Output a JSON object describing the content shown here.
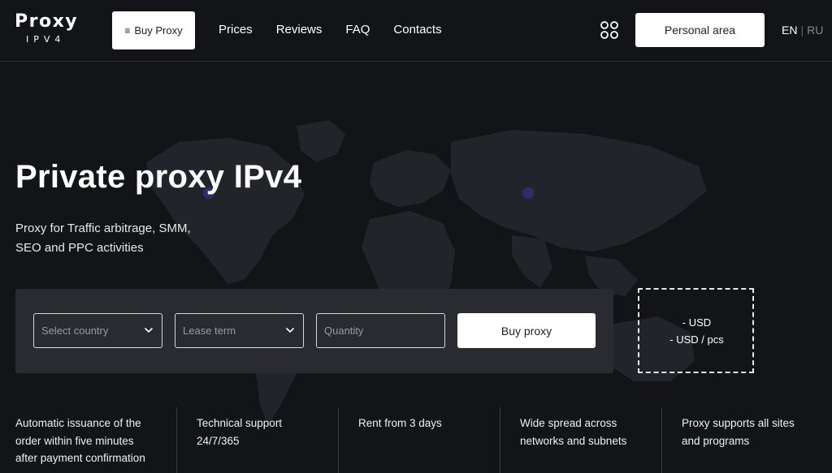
{
  "header": {
    "logo": {
      "main": "Proxy",
      "sub": "IPV4"
    },
    "buy_button": {
      "icon": "menu-icon",
      "label": "Buy Proxy"
    },
    "nav": [
      {
        "label": "Prices"
      },
      {
        "label": "Reviews"
      },
      {
        "label": "FAQ"
      },
      {
        "label": "Contacts"
      }
    ],
    "apps_icon": "grid-apps-icon",
    "personal_area_label": "Personal area",
    "lang": {
      "active": "EN",
      "separator": "|",
      "other": "RU"
    }
  },
  "hero": {
    "title": "Private proxy IPv4",
    "subtitle_line1": "Proxy for Traffic arbitrage, SMM,",
    "subtitle_line2": "SEO and PPC activities"
  },
  "order_form": {
    "country_placeholder": "Select country",
    "lease_placeholder": "Lease term",
    "quantity_placeholder": "Quantity",
    "buy_label": "Buy proxy",
    "price_total": "- USD",
    "price_per_unit": "- USD / pcs"
  },
  "features": [
    {
      "line1": "Automatic issuance of the",
      "line2": "order within five minutes",
      "line3": "after payment confirmation"
    },
    {
      "line1": "Technical support",
      "line2": "24/7/365",
      "line3": ""
    },
    {
      "line1": "Rent from 3 days",
      "line2": "",
      "line3": ""
    },
    {
      "line1": "Wide spread across",
      "line2": "networks and subnets",
      "line3": ""
    },
    {
      "line1": "Proxy supports all sites",
      "line2": "and programs",
      "line3": ""
    }
  ],
  "colors": {
    "background": "#131418",
    "panel": "#2a2b30",
    "button": "#ffffff",
    "map_dots": "#3b3d44",
    "map_highlight": "#3d3f7a"
  }
}
